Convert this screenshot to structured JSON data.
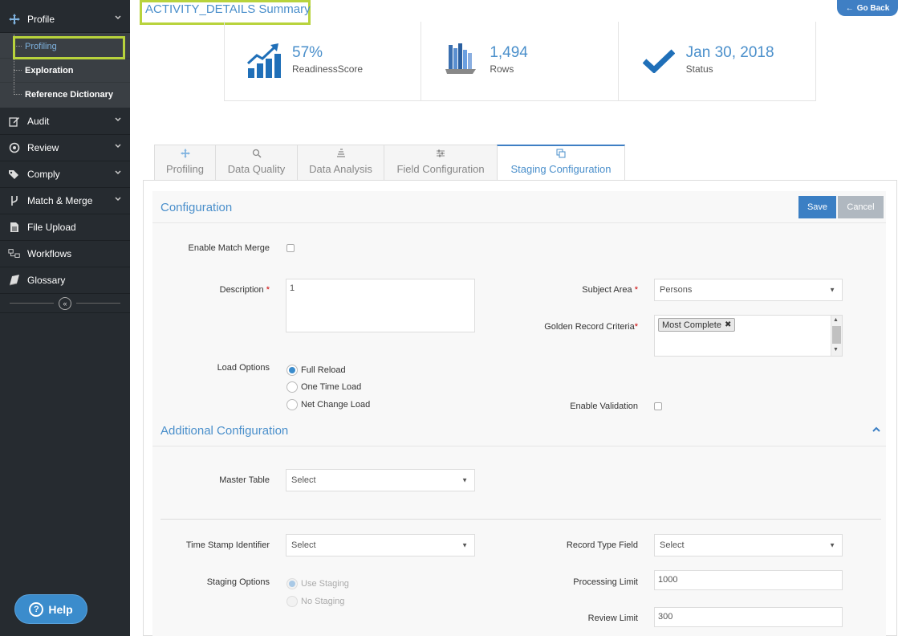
{
  "sidebar": {
    "items": [
      {
        "label": "Profile",
        "icon": "crosshair-icon"
      },
      {
        "label": "Audit",
        "icon": "edit-icon"
      },
      {
        "label": "Review",
        "icon": "target-icon"
      },
      {
        "label": "Comply",
        "icon": "tags-icon"
      },
      {
        "label": "Match & Merge",
        "icon": "branch-icon"
      },
      {
        "label": "File Upload",
        "icon": "file-icon"
      },
      {
        "label": "Workflows",
        "icon": "workflow-icon"
      },
      {
        "label": "Glossary",
        "icon": "book-icon"
      }
    ],
    "sub_items": [
      {
        "label": "Profiling"
      },
      {
        "label": "Exploration"
      },
      {
        "label": "Reference Dictionary"
      }
    ],
    "help_label": "Help"
  },
  "header": {
    "title": "ACTIVITY_DETAILS Summary",
    "go_back_label": "Go Back"
  },
  "stats": [
    {
      "value": "57%",
      "label": "ReadinessScore",
      "icon": "chart-up-icon"
    },
    {
      "value": "1,494",
      "label": "Rows",
      "icon": "server-icon"
    },
    {
      "value": "Jan 30, 2018",
      "label": "Status",
      "icon": "checkmark-icon"
    }
  ],
  "tabs": [
    {
      "label": "Profiling"
    },
    {
      "label": "Data Quality"
    },
    {
      "label": "Data Analysis"
    },
    {
      "label": "Field Configuration"
    },
    {
      "label": "Staging Configuration"
    }
  ],
  "config": {
    "section_title": "Configuration",
    "save_label": "Save",
    "cancel_label": "Cancel",
    "enable_match_merge_label": "Enable Match Merge",
    "description_label": "Description",
    "description_value": "1",
    "subject_area_label": "Subject Area",
    "subject_area_value": "Persons",
    "golden_record_label": "Golden Record Criteria",
    "golden_record_tag": "Most Complete",
    "load_options_label": "Load Options",
    "load_options": [
      "Full Reload",
      "One Time Load",
      "Net Change Load"
    ],
    "enable_validation_label": "Enable Validation",
    "required_mark": "*"
  },
  "additional": {
    "section_title": "Additional Configuration",
    "master_table_label": "Master Table",
    "master_table_value": "Select",
    "timestamp_label": "Time Stamp Identifier",
    "timestamp_value": "Select",
    "record_type_label": "Record Type Field",
    "record_type_value": "Select",
    "staging_options_label": "Staging Options",
    "staging_options": [
      "Use Staging",
      "No Staging"
    ],
    "processing_limit_label": "Processing Limit",
    "processing_limit_value": "1000",
    "review_limit_label": "Review Limit",
    "review_limit_value": "300"
  },
  "colors": {
    "accent": "#4a8fcb",
    "sidebar_bg": "#262b30",
    "highlight": "#b8d33c",
    "save_button": "#3b7fc4",
    "cancel_button": "#b0b8c0"
  }
}
